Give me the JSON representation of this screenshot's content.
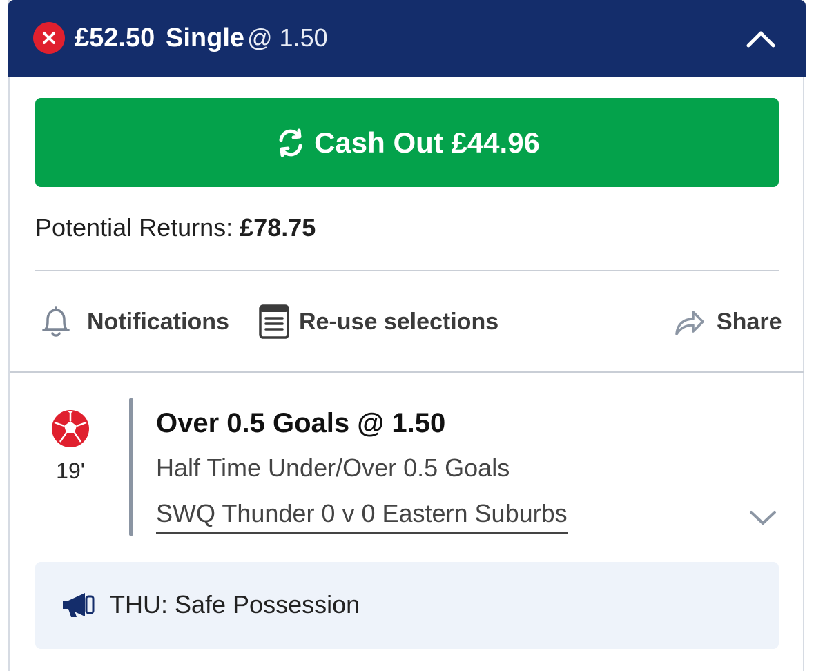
{
  "header": {
    "stake": "£52.50",
    "bet_type": "Single",
    "odds": "@ 1.50",
    "status_icon": "close-circle-icon",
    "status_color": "#e0202e",
    "collapse_icon": "chevron-up-icon",
    "bg_color": "#142d6b"
  },
  "cashout": {
    "label": "Cash Out £44.96",
    "icon": "refresh-icon",
    "color": "#04a24b"
  },
  "returns": {
    "label": "Potential Returns:",
    "value": "£78.75"
  },
  "actions": [
    {
      "label": "Notifications",
      "icon": "bell-icon"
    },
    {
      "label": "Re-use selections",
      "icon": "document-icon"
    },
    {
      "label": "Share",
      "icon": "share-arrow-icon"
    }
  ],
  "selection": {
    "sport_icon": "football-icon",
    "minute": "19'",
    "title": "Over 0.5 Goals @ 1.50",
    "market": "Half Time Under/Over 0.5 Goals",
    "event": "SWQ Thunder 0 v 0 Eastern Suburbs",
    "expand_icon": "chevron-down-icon"
  },
  "promo": {
    "icon": "megaphone-icon",
    "text": "THU: Safe Possession"
  }
}
